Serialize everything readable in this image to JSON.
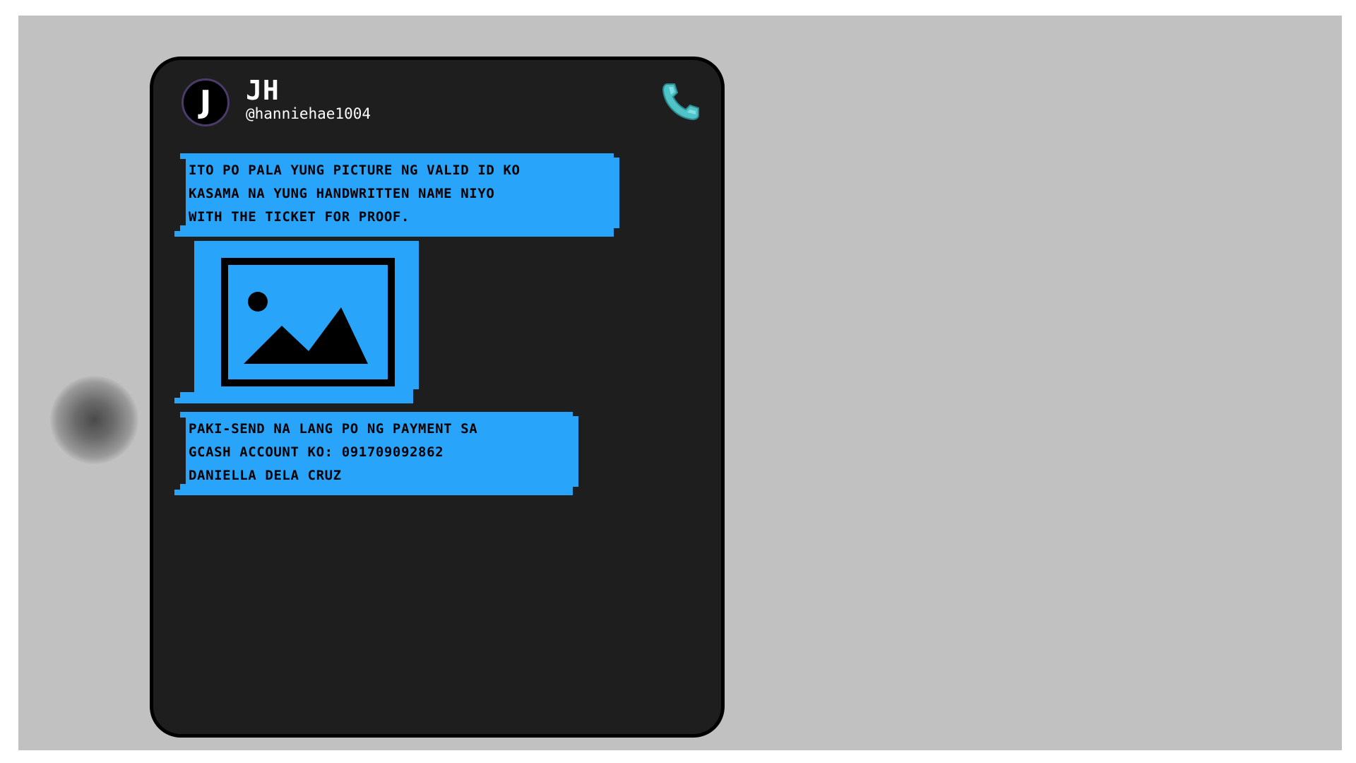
{
  "chat": {
    "contact": {
      "avatar_letter": "J",
      "name": "JH",
      "handle": "@hanniehae1004"
    },
    "call_icon": "phone-icon",
    "messages": [
      {
        "type": "text",
        "text": "ITO PO PALA YUNG PICTURE NG VALID ID KO\nKASAMA NA YUNG HANDWRITTEN NAME NIYO\nWITH THE TICKET FOR PROOF."
      },
      {
        "type": "image",
        "icon": "image-placeholder-icon"
      },
      {
        "type": "text",
        "text": "PAKI-SEND NA LANG PO NG PAYMENT SA\nGCASH ACCOUNT KO: 091709092862\nDANIELLA DELA CRUZ"
      }
    ]
  },
  "colors": {
    "background": "#c1c1c1",
    "phone": "#1e1e1e",
    "bubble": "#28a5fa",
    "call_icon": "#4fc3c7"
  }
}
